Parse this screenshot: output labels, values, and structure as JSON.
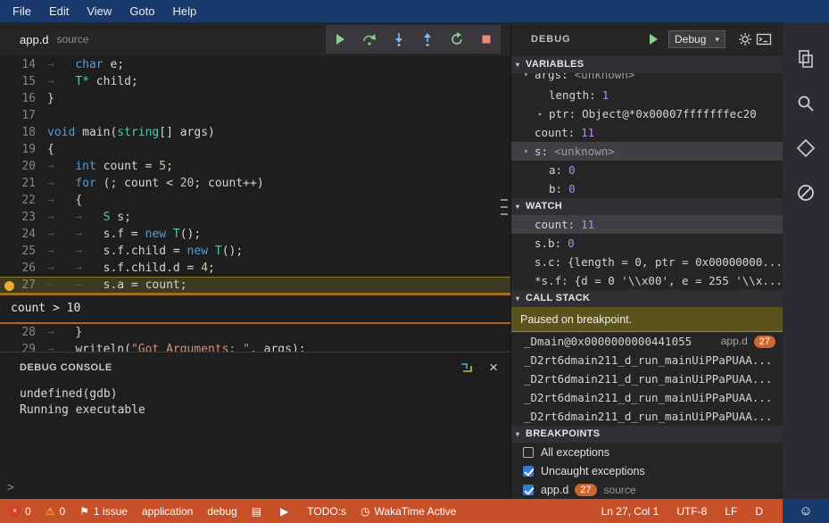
{
  "colors": {
    "menu_bar": "#1a3a6e",
    "status_bar": "#c75029",
    "accent_orange": "#cc6633",
    "breakpoint_yellow": "#e8b028",
    "paused_banner": "#5a531e"
  },
  "menu": {
    "items": [
      "File",
      "Edit",
      "View",
      "Goto",
      "Help"
    ]
  },
  "editor": {
    "tab": {
      "file": "app.d",
      "kind": "source"
    },
    "toolbar": {
      "icons": [
        "continue",
        "step-over",
        "step-into",
        "step-out",
        "restart",
        "stop"
      ]
    },
    "peek_text": "count > 10",
    "lines_top": [
      {
        "no": 14,
        "ind": 1,
        "tok": [
          [
            "kw",
            "char"
          ],
          [
            "pl",
            " e;"
          ]
        ]
      },
      {
        "no": 15,
        "ind": 1,
        "tok": [
          [
            "ty",
            "T*"
          ],
          [
            "pl",
            " child;"
          ]
        ]
      },
      {
        "no": 16,
        "ind": 0,
        "tok": [
          [
            "pl",
            "}"
          ]
        ]
      },
      {
        "no": 17,
        "ind": 0,
        "tok": []
      },
      {
        "no": 18,
        "ind": 0,
        "tok": [
          [
            "kw",
            "void"
          ],
          [
            "pl",
            " main("
          ],
          [
            "ty",
            "string"
          ],
          [
            "pl",
            "[] args)"
          ]
        ]
      },
      {
        "no": 19,
        "ind": 0,
        "tok": [
          [
            "pl",
            "{"
          ]
        ]
      },
      {
        "no": 20,
        "ind": 1,
        "tok": [
          [
            "kw",
            "int"
          ],
          [
            "pl",
            " count = "
          ],
          [
            "nm",
            "5"
          ],
          [
            "pl",
            ";"
          ]
        ]
      },
      {
        "no": 21,
        "ind": 1,
        "tok": [
          [
            "kw",
            "for"
          ],
          [
            "pl",
            " (; count < "
          ],
          [
            "nm",
            "20"
          ],
          [
            "pl",
            "; count++)"
          ]
        ]
      },
      {
        "no": 22,
        "ind": 1,
        "tok": [
          [
            "pl",
            "{"
          ]
        ]
      },
      {
        "no": 23,
        "ind": 2,
        "tok": [
          [
            "ty",
            "S"
          ],
          [
            "pl",
            " s;"
          ]
        ]
      },
      {
        "no": 24,
        "ind": 2,
        "tok": [
          [
            "pl",
            "s.f = "
          ],
          [
            "kw",
            "new"
          ],
          [
            "pl",
            " "
          ],
          [
            "ty",
            "T"
          ],
          [
            "pl",
            "();"
          ]
        ]
      },
      {
        "no": 25,
        "ind": 2,
        "tok": [
          [
            "pl",
            "s.f.child = "
          ],
          [
            "kw",
            "new"
          ],
          [
            "pl",
            " "
          ],
          [
            "ty",
            "T"
          ],
          [
            "pl",
            "();"
          ]
        ]
      },
      {
        "no": 26,
        "ind": 2,
        "tok": [
          [
            "pl",
            "s.f.child.d = "
          ],
          [
            "nm",
            "4"
          ],
          [
            "pl",
            ";"
          ]
        ]
      },
      {
        "no": 27,
        "ind": 2,
        "hl": true,
        "bp": true,
        "tok": [
          [
            "pl",
            "s.a = count;"
          ]
        ]
      }
    ],
    "lines_bottom": [
      {
        "no": 28,
        "ind": 1,
        "tok": [
          [
            "pl",
            "}"
          ]
        ]
      },
      {
        "no": 29,
        "ind": 1,
        "tok": [
          [
            "pl",
            "writeln("
          ],
          [
            "st",
            "\"Got Arguments: \""
          ],
          [
            "pl",
            ", args);"
          ]
        ]
      }
    ],
    "console": {
      "title": "DEBUG CONSOLE",
      "lines": [
        "undefined(gdb)",
        "Running executable"
      ],
      "prompt": ">"
    }
  },
  "debug_panel": {
    "title": "DEBUG",
    "config": "Debug",
    "variables": {
      "title": "VARIABLES",
      "rows": [
        {
          "arrow": "▾",
          "name": "args:",
          "value": "<unknown>"
        },
        {
          "name": "length:",
          "value": "1"
        },
        {
          "arrow": "▸",
          "name": "ptr:",
          "value": "Object@*0x00007fffffffec20"
        },
        {
          "name": "count:",
          "value": "11"
        },
        {
          "arrow": "▾",
          "name": "s:",
          "value": "<unknown>"
        },
        {
          "name": "a:",
          "value": "0"
        },
        {
          "name": "b:",
          "value": "0"
        }
      ]
    },
    "watch": {
      "title": "WATCH",
      "rows": [
        {
          "name": "count:",
          "value": "11"
        },
        {
          "name": "s.b:",
          "value": "0"
        },
        {
          "name": "s.c:",
          "value": "{length = 0, ptr = 0x00000000..."
        },
        {
          "name": "*s.f:",
          "value": "{d = 0 '\\\\x00', e = 255 '\\\\x..."
        }
      ]
    },
    "call_stack": {
      "title": "CALL STACK",
      "message": "Paused on breakpoint.",
      "frames": [
        {
          "name": "_Dmain@0x0000000000441055",
          "file": "app.d",
          "line": "27"
        },
        {
          "name": "_D2rt6dmain211_d_run_mainUiPPaPUAA..."
        },
        {
          "name": "_D2rt6dmain211_d_run_mainUiPPaPUAA..."
        },
        {
          "name": "_D2rt6dmain211_d_run_mainUiPPaPUAA..."
        },
        {
          "name": "_D2rt6dmain211_d_run_mainUiPPaPUAA..."
        }
      ]
    },
    "breakpoints": {
      "title": "BREAKPOINTS",
      "rows": [
        {
          "checked": false,
          "label": "All exceptions"
        },
        {
          "checked": true,
          "label": "Uncaught exceptions"
        },
        {
          "checked": true,
          "label": "app.d",
          "line": "27",
          "suffix": "source"
        }
      ]
    }
  },
  "activity_bar": {
    "icons": [
      "files",
      "search",
      "package",
      "debug-disabled"
    ]
  },
  "status_bar": {
    "errors": "0",
    "warnings": "0",
    "issues": "1 issue",
    "application": "application",
    "debug": "debug",
    "todo": "TODO:s",
    "wakatime": "WakaTime Active",
    "line_col": "Ln 27, Col 1",
    "encoding": "UTF-8",
    "eol": "LF",
    "language": "D"
  }
}
